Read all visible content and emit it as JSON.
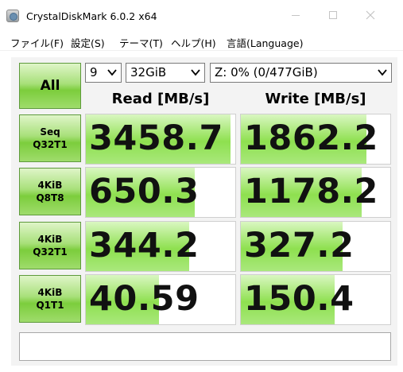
{
  "window": {
    "title": "CrystalDiskMark 6.0.2 x64",
    "icon": "crystaldiskmark-app-icon",
    "controls": {
      "minimize": "minimize-icon",
      "maximize": "maximize-icon",
      "close": "close-icon"
    }
  },
  "menu": [
    {
      "label": "ファイル(F)"
    },
    {
      "label": "設定(S)"
    },
    {
      "label": "テーマ(T)"
    },
    {
      "label": "ヘルプ(H)"
    },
    {
      "label": "言語(Language)"
    }
  ],
  "controls": {
    "all_button": "All",
    "test_count": "9",
    "test_size": "32GiB",
    "drive": "Z: 0% (0/477GiB)"
  },
  "headers": {
    "read": "Read [MB/s]",
    "write": "Write [MB/s]"
  },
  "tests": [
    {
      "line1": "Seq",
      "line2": "Q32T1",
      "read": "3458.7",
      "write": "1862.2",
      "read_fill_pct": 97,
      "write_fill_pct": 84
    },
    {
      "line1": "4KiB",
      "line2": "Q8T8",
      "read": "650.3",
      "write": "1178.2",
      "read_fill_pct": 73,
      "write_fill_pct": 81
    },
    {
      "line1": "4KiB",
      "line2": "Q32T1",
      "read": "344.2",
      "write": "327.2",
      "read_fill_pct": 69,
      "write_fill_pct": 68
    },
    {
      "line1": "4KiB",
      "line2": "Q1T1",
      "read": "40.59",
      "write": "150.4",
      "read_fill_pct": 49,
      "write_fill_pct": 63
    }
  ],
  "status": "",
  "colors": {
    "button_green": "#7ccd3c",
    "bar_green": "#8ee04f",
    "panel_bg": "#f3f3f3"
  }
}
